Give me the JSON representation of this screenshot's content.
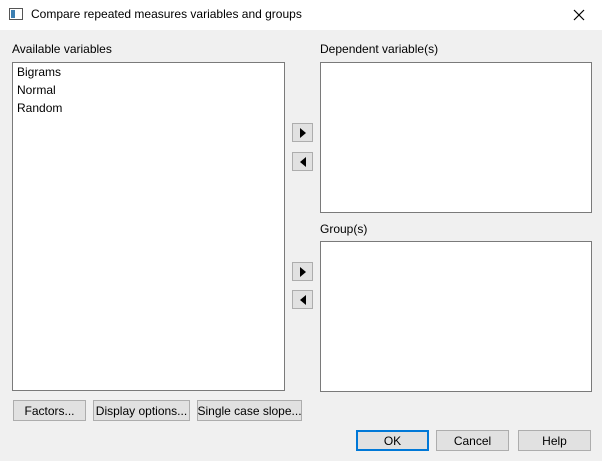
{
  "window": {
    "title": "Compare repeated measures variables and groups",
    "close_icon": "close-icon"
  },
  "available": {
    "label": "Available variables",
    "items": [
      "Bigrams",
      "Normal",
      "Random"
    ]
  },
  "dependent": {
    "label": "Dependent variable(s)",
    "items": []
  },
  "groups": {
    "label": "Group(s)",
    "items": []
  },
  "buttons": {
    "factors": "Factors...",
    "display_options": "Display options...",
    "single_case_slope": "Single case slope...",
    "ok": "OK",
    "cancel": "Cancel",
    "help": "Help"
  },
  "colors": {
    "default_button_border": "#0078d7",
    "dialog_background": "#f0f0f0"
  }
}
